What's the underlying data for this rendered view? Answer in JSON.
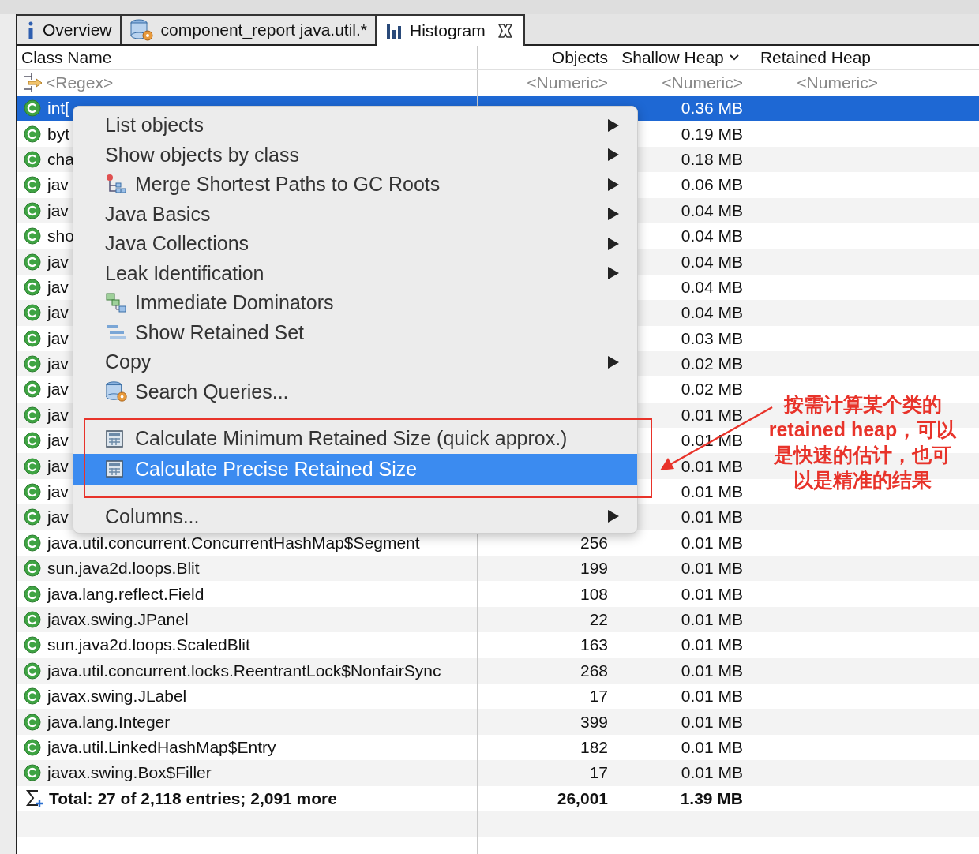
{
  "tabs": [
    {
      "label": "Overview",
      "selected": false,
      "closable": false
    },
    {
      "label": "component_report java.util.*",
      "selected": false,
      "closable": false
    },
    {
      "label": "Histogram",
      "selected": true,
      "closable": true
    }
  ],
  "table": {
    "columns": [
      {
        "label": "Class Name",
        "sorted": false
      },
      {
        "label": "Objects",
        "sorted": false
      },
      {
        "label": "Shallow Heap",
        "sorted": true
      },
      {
        "label": "Retained Heap",
        "sorted": false
      }
    ],
    "filters": [
      "<Regex>",
      "<Numeric>",
      "<Numeric>",
      "<Numeric>"
    ],
    "rows": [
      {
        "name": "int[",
        "shallow": "0.36 MB",
        "selected": true
      },
      {
        "name": "byt",
        "shallow": "0.19 MB",
        "selected": false
      },
      {
        "name": "cha",
        "shallow": "0.18 MB",
        "selected": false
      },
      {
        "name": "jav",
        "shallow": "0.06 MB",
        "selected": false
      },
      {
        "name": "jav",
        "shallow": "0.04 MB",
        "selected": false
      },
      {
        "name": "sho",
        "shallow": "0.04 MB",
        "selected": false
      },
      {
        "name": "jav",
        "shallow": "0.04 MB",
        "selected": false
      },
      {
        "name": "jav",
        "shallow": "0.04 MB",
        "selected": false
      },
      {
        "name": "jav",
        "shallow": "0.04 MB",
        "selected": false
      },
      {
        "name": "jav",
        "shallow": "0.03 MB",
        "selected": false
      },
      {
        "name": "jav",
        "shallow": "0.02 MB",
        "selected": false
      },
      {
        "name": "jav",
        "shallow": "0.02 MB",
        "selected": false
      },
      {
        "name": "jav",
        "shallow": "0.01 MB",
        "selected": false
      },
      {
        "name": "jav",
        "shallow": "0.01 MB",
        "selected": false
      },
      {
        "name": "jav",
        "shallow": "0.01 MB",
        "selected": false
      },
      {
        "name": "jav",
        "shallow": "0.01 MB",
        "selected": false
      },
      {
        "name": "jav",
        "shallow": "0.01 MB",
        "selected": false
      },
      {
        "name": "java.util.concurrent.ConcurrentHashMap$Segment",
        "objects": "256",
        "shallow": "0.01 MB",
        "selected": false
      },
      {
        "name": "sun.java2d.loops.Blit",
        "objects": "199",
        "shallow": "0.01 MB",
        "selected": false
      },
      {
        "name": "java.lang.reflect.Field",
        "objects": "108",
        "shallow": "0.01 MB",
        "selected": false
      },
      {
        "name": "javax.swing.JPanel",
        "objects": "22",
        "shallow": "0.01 MB",
        "selected": false
      },
      {
        "name": "sun.java2d.loops.ScaledBlit",
        "objects": "163",
        "shallow": "0.01 MB",
        "selected": false
      },
      {
        "name": "java.util.concurrent.locks.ReentrantLock$NonfairSync",
        "objects": "268",
        "shallow": "0.01 MB",
        "selected": false
      },
      {
        "name": "javax.swing.JLabel",
        "objects": "17",
        "shallow": "0.01 MB",
        "selected": false
      },
      {
        "name": "java.lang.Integer",
        "objects": "399",
        "shallow": "0.01 MB",
        "selected": false
      },
      {
        "name": "java.util.LinkedHashMap$Entry",
        "objects": "182",
        "shallow": "0.01 MB",
        "selected": false
      },
      {
        "name": "javax.swing.Box$Filler",
        "objects": "17",
        "shallow": "0.01 MB",
        "selected": false
      }
    ],
    "total": {
      "label": "Total: 27 of 2,118 entries; 2,091 more",
      "objects": "26,001",
      "shallow": "1.39 MB"
    }
  },
  "context_menu": {
    "items": [
      {
        "kind": "item",
        "label": "List objects",
        "submenu": true,
        "selected": false
      },
      {
        "kind": "item",
        "label": "Show objects by class",
        "submenu": true,
        "selected": false
      },
      {
        "kind": "item",
        "label": "Merge Shortest Paths to GC Roots",
        "submenu": true,
        "selected": false
      },
      {
        "kind": "item",
        "label": "Java Basics",
        "submenu": true,
        "selected": false
      },
      {
        "kind": "item",
        "label": "Java Collections",
        "submenu": true,
        "selected": false
      },
      {
        "kind": "item",
        "label": "Leak Identification",
        "submenu": true,
        "selected": false
      },
      {
        "kind": "item",
        "label": "Immediate Dominators",
        "submenu": false,
        "selected": false
      },
      {
        "kind": "item",
        "label": "Show Retained Set",
        "submenu": false,
        "selected": false
      },
      {
        "kind": "item",
        "label": "Copy",
        "submenu": true,
        "selected": false
      },
      {
        "kind": "item",
        "label": "Search Queries...",
        "submenu": false,
        "selected": false
      },
      {
        "kind": "separator"
      },
      {
        "kind": "item",
        "label": "Calculate Minimum Retained Size (quick approx.)",
        "submenu": false,
        "selected": false
      },
      {
        "kind": "item",
        "label": "Calculate Precise Retained Size",
        "submenu": false,
        "selected": true
      },
      {
        "kind": "separator"
      },
      {
        "kind": "item",
        "label": "Columns...",
        "submenu": true,
        "selected": false
      }
    ]
  },
  "annotation": {
    "lines": [
      "按需计算某个类的",
      "**retained heap**，可以",
      "是快速的估计，也可",
      "以是精准的结果"
    ]
  }
}
